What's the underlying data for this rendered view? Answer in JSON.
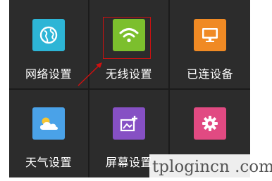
{
  "tiles": [
    {
      "label": "网络设置",
      "icon": "globe-icon",
      "color": "#2db5d6"
    },
    {
      "label": "无线设置",
      "icon": "wifi-icon",
      "color": "#7cbf2d"
    },
    {
      "label": "已连设备",
      "icon": "monitor-icon",
      "color": "#f08a24"
    },
    {
      "label": "天气设置",
      "icon": "weather-icon",
      "color": "#4aa2e8"
    },
    {
      "label": "屏幕设置",
      "icon": "screen-icon",
      "color": "#8650c4"
    },
    {
      "label": "",
      "icon": "gear-icon",
      "color": "#e14a82"
    }
  ],
  "watermark": "tplogincn .com",
  "highlight_color": "#d01010"
}
